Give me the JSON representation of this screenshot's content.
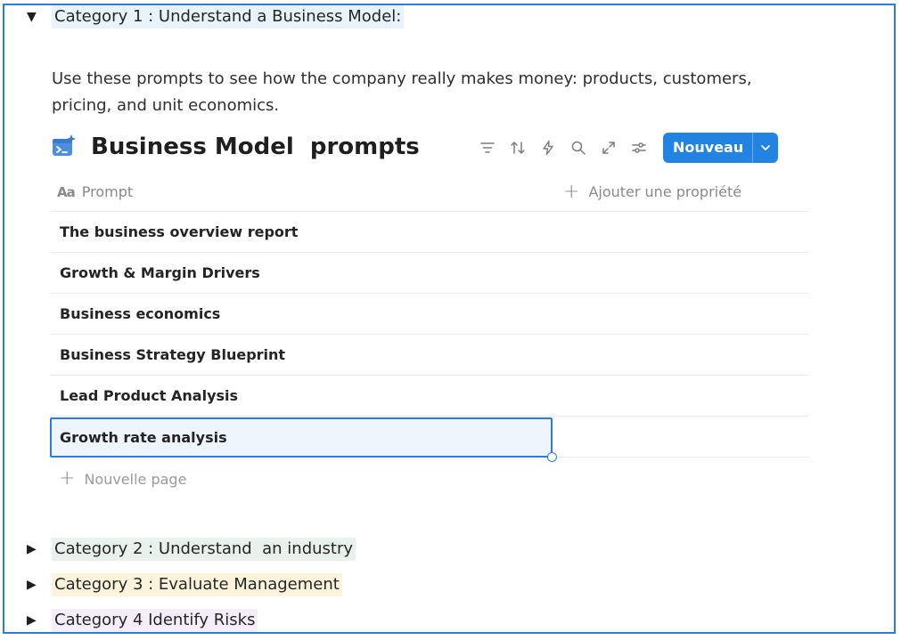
{
  "colors": {
    "accent": "#2383e2",
    "frame_border": "#2d7dd2"
  },
  "category1": {
    "title": "Category 1 : Understand a Business Model:",
    "arrow": "▼",
    "intro": "Use these prompts to see how the company really makes money: products, customers, pricing, and unit economics."
  },
  "database": {
    "icon": "terminal-sparkle-icon",
    "title": "Business Model  prompts",
    "toolbar": {
      "icons": [
        "filter-icon",
        "sort-icon",
        "automation-bolt-icon",
        "search-icon",
        "expand-icon",
        "settings-sliders-icon"
      ],
      "new_label": "Nouveau"
    },
    "columns": {
      "prompt": "Prompt",
      "add_property": "Ajouter une propriété"
    },
    "rows": [
      "The business overview report",
      "Growth & Margin Drivers",
      "Business economics",
      "Business Strategy Blueprint",
      "Lead Product Analysis",
      "Growth rate analysis"
    ],
    "new_page": "Nouvelle page"
  },
  "categories": [
    {
      "arrow": "▶",
      "title": "Category 2 : Understand  an industry"
    },
    {
      "arrow": "▶",
      "title": "Category 3 : Evaluate Management"
    },
    {
      "arrow": "▶",
      "title": "Category 4 Identify Risks"
    }
  ]
}
